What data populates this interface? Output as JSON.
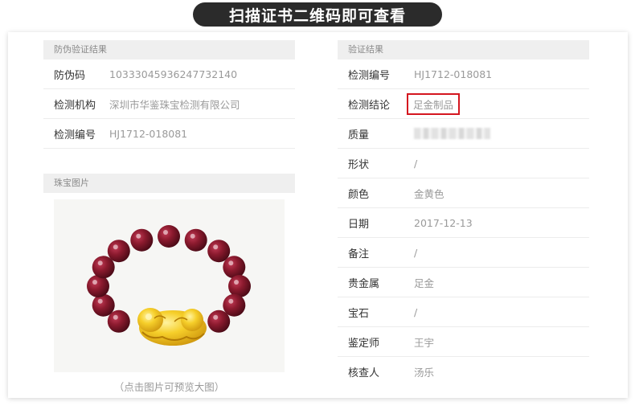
{
  "banner": {
    "title": "扫描证书二维码即可查看"
  },
  "anti_counterfeit": {
    "header": "防伪验证结果",
    "rows": [
      {
        "label": "防伪码",
        "value": "10333045936247732140"
      },
      {
        "label": "检测机构",
        "value": "深圳市华鉴珠宝检测有限公司"
      },
      {
        "label": "检测编号",
        "value": "HJ1712-018081"
      }
    ]
  },
  "jewelry_photo": {
    "header": "珠宝图片",
    "caption": "（点击图片可预览大图）"
  },
  "verification": {
    "header": "验证结果",
    "rows": [
      {
        "label": "检测编号",
        "value": "HJ1712-018081"
      },
      {
        "label": "检测结论",
        "value": "足金制品"
      },
      {
        "label": "质量",
        "value": ""
      },
      {
        "label": "形状",
        "value": "/"
      },
      {
        "label": "颜色",
        "value": "金黄色"
      },
      {
        "label": "日期",
        "value": "2017-12-13"
      },
      {
        "label": "备注",
        "value": "/"
      },
      {
        "label": "贵金属",
        "value": "足金"
      },
      {
        "label": "宝石",
        "value": "/"
      },
      {
        "label": "鉴定师",
        "value": "王宇"
      },
      {
        "label": "核查人",
        "value": "汤乐"
      }
    ]
  },
  "colors": {
    "banner_bg": "#2b2b2b",
    "highlight_border": "#d4161f",
    "bead": "#8b1a2e",
    "gold": "#f2c01a"
  }
}
